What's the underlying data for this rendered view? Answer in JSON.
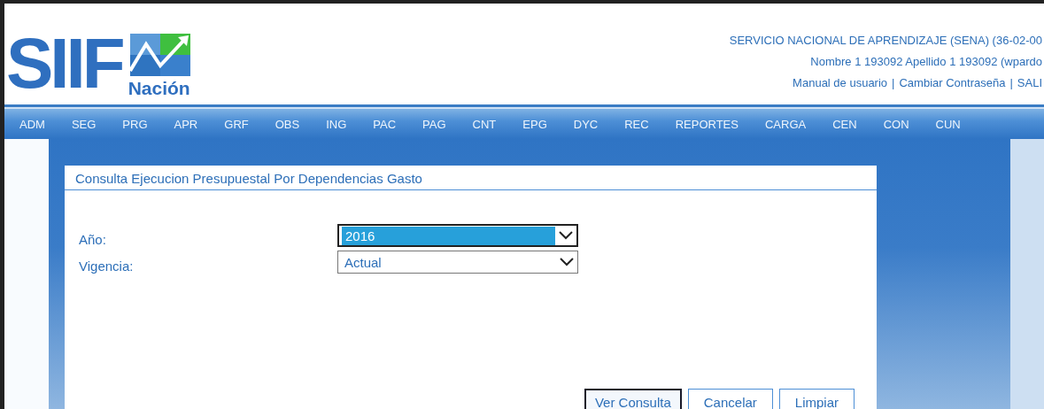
{
  "logo": {
    "wordmark": "SIIF",
    "subtitle": "Nación"
  },
  "header": {
    "entity": "SERVICIO NACIONAL DE APRENDIZAJE (SENA) (36-02-00",
    "user": "Nombre 1 193092 Apellido 1 193092 (wpardo",
    "links": [
      "Manual de usuario",
      "Cambiar Contraseña",
      "SALI"
    ],
    "separator": "|"
  },
  "menu": [
    "ADM",
    "SEG",
    "PRG",
    "APR",
    "GRF",
    "OBS",
    "ING",
    "PAC",
    "PAG",
    "CNT",
    "EPG",
    "DYC",
    "REC",
    "REPORTES",
    "CARGA",
    "CEN",
    "CON",
    "CUN"
  ],
  "form": {
    "title": "Consulta Ejecucion Presupuestal Por Dependencias Gasto",
    "fields": [
      {
        "label": "Año:",
        "value": "2016",
        "focused": true
      },
      {
        "label": "Vigencia:",
        "value": "Actual",
        "focused": false
      }
    ],
    "buttons": [
      {
        "label": "Ver Consulta",
        "default": true
      },
      {
        "label": "Cancelar",
        "default": false
      },
      {
        "label": "Limpiar",
        "default": false
      }
    ]
  }
}
